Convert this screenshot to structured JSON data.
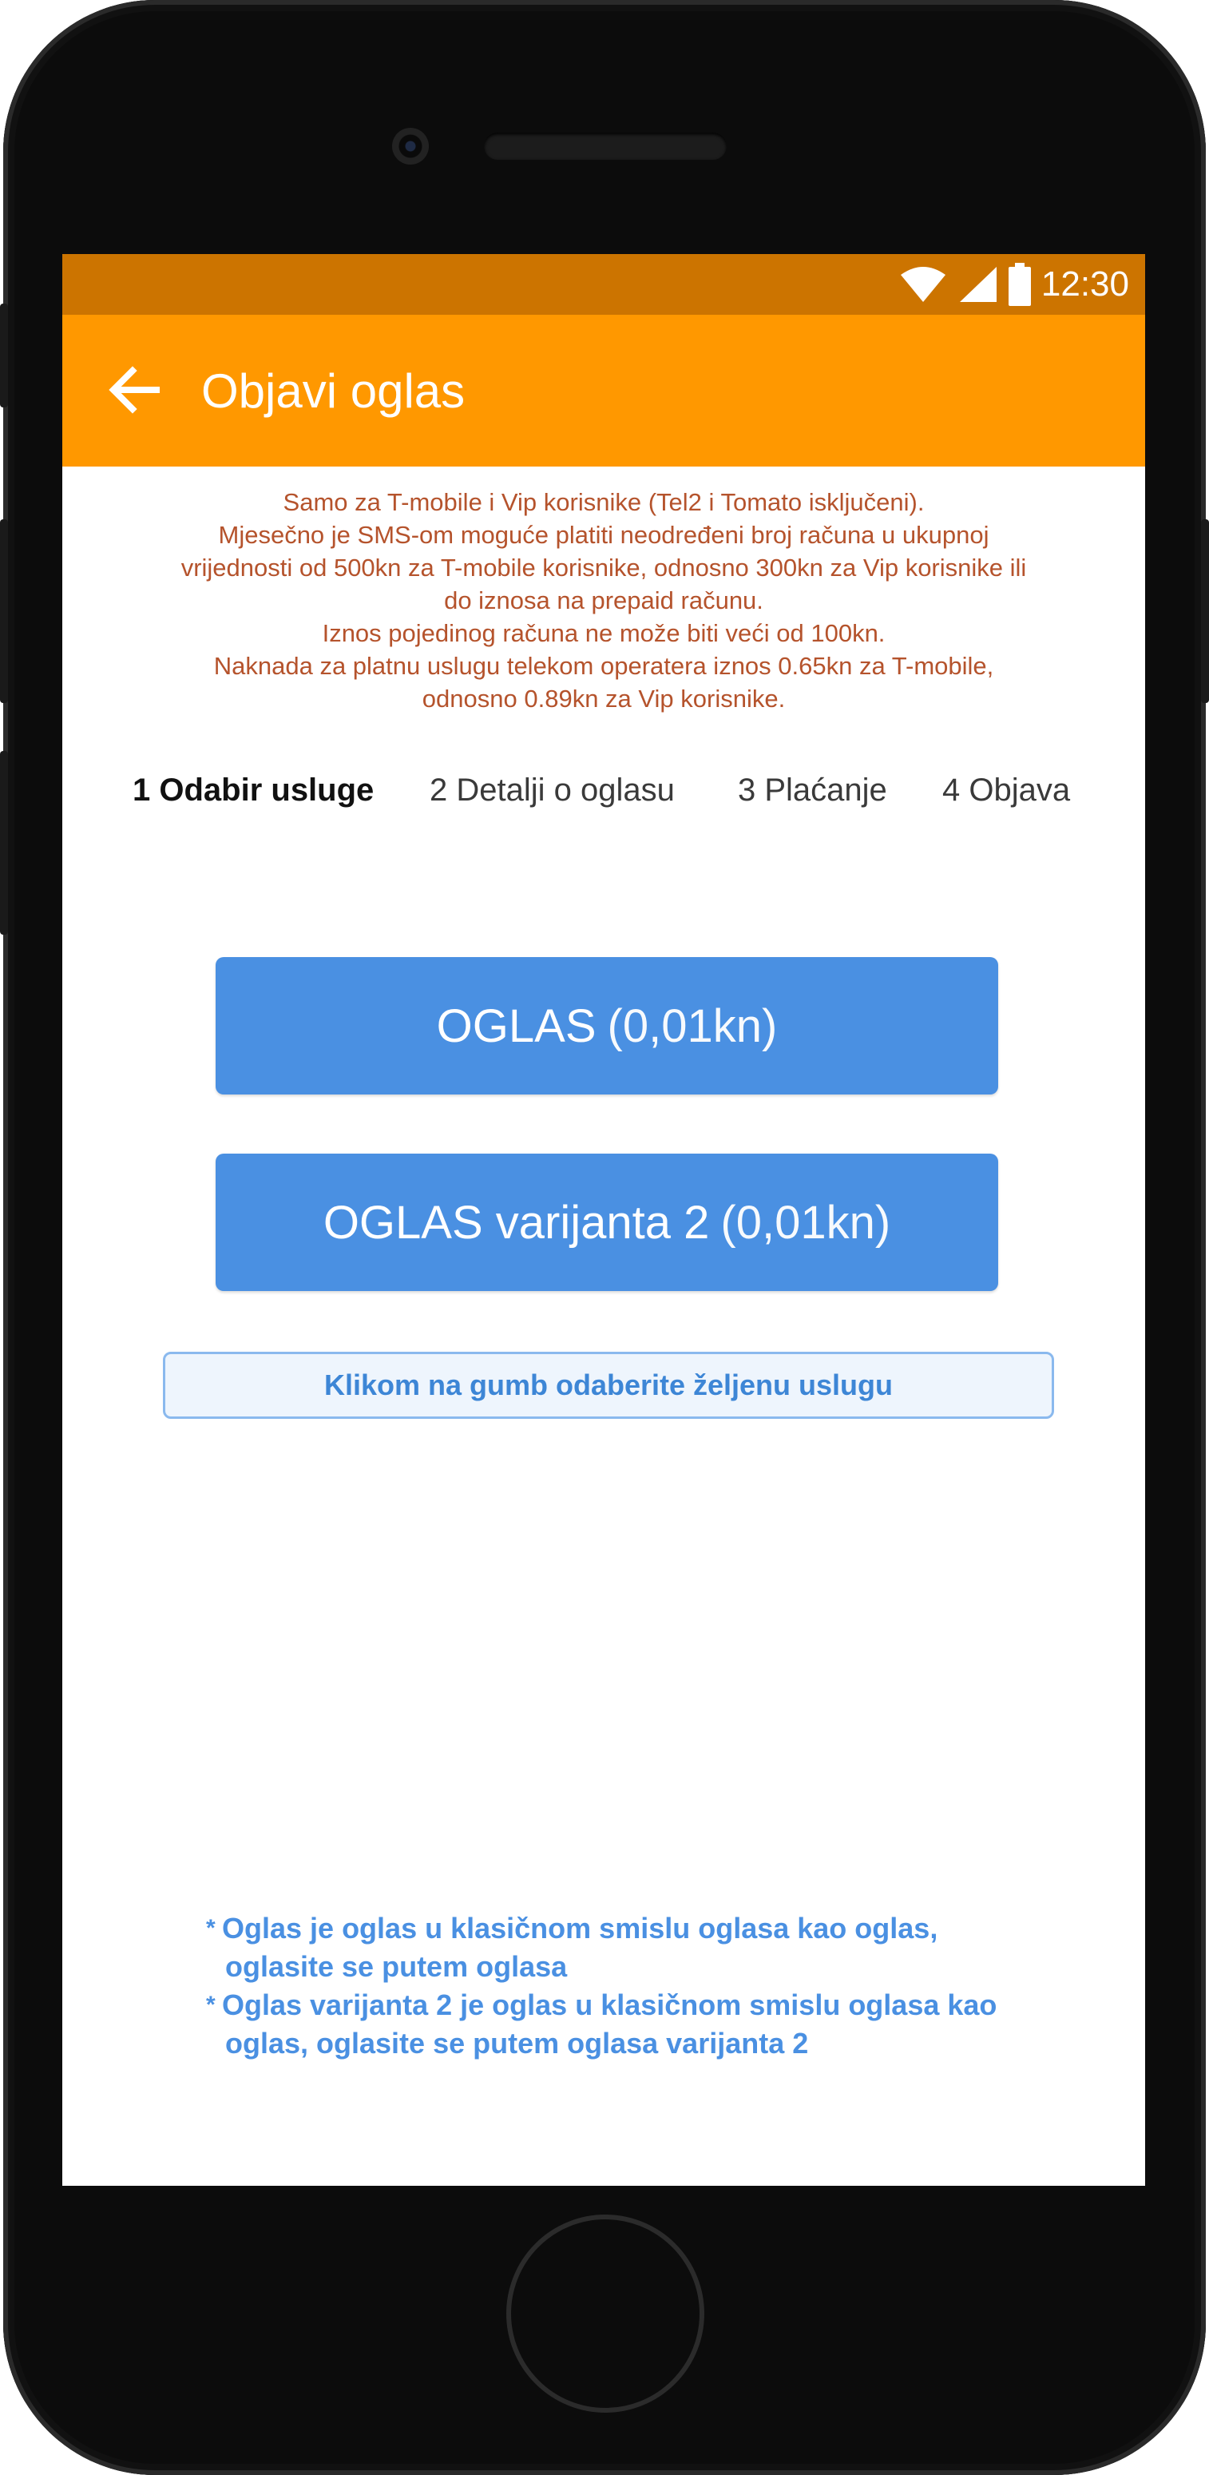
{
  "status_bar": {
    "time": "12:30",
    "icons": [
      "wifi-icon",
      "signal-icon",
      "battery-icon"
    ]
  },
  "app_bar": {
    "title": "Objavi oglas",
    "back_icon": "arrow-left-icon"
  },
  "notice": {
    "lines": [
      "Samo za T-mobile i Vip korisnike (Tel2 i Tomato isključeni).",
      "Mjesečno je SMS-om moguće platiti neodređeni broj računa u ukupnoj",
      "vrijednosti od 500kn za T-mobile korisnike, odnosno 300kn za Vip korisnike ili",
      "do iznosa na prepaid računu.",
      "Iznos pojedinog računa ne može biti veći od 100kn.",
      "Naknada za platnu uslugu telekom operatera iznos 0.65kn za T-mobile,",
      "odnosno 0.89kn za Vip korisnike."
    ]
  },
  "steps": [
    {
      "label": "1 Odabir usluge",
      "active": true
    },
    {
      "label": "2 Detalji o oglasu",
      "active": false
    },
    {
      "label": "3 Plaćanje",
      "active": false
    },
    {
      "label": "4 Objava",
      "active": false
    }
  ],
  "services": [
    {
      "name": "OGLAS",
      "price": "(0,01kn)"
    },
    {
      "name": "OGLAS varijanta 2",
      "price": "(0,01kn)"
    }
  ],
  "hint": "Klikom na gumb odaberite željenu uslugu",
  "footnotes": [
    {
      "star": "*",
      "line1": "Oglas je oglas u klasičnom smislu oglasa kao oglas,",
      "line2": "oglasite se putem oglasa"
    },
    {
      "star": "*",
      "line1": "Oglas varijanta 2 je oglas u klasičnom smislu oglasa kao",
      "line2": "oglas, oglasite se putem oglasa varijanta 2"
    }
  ],
  "colors": {
    "status_bar": "#cc7400",
    "app_bar": "#ff9800",
    "notice_text": "#b5532c",
    "button": "#4a90e2",
    "hint_text": "#3d86d6",
    "footnote_text": "#4a90e2"
  }
}
